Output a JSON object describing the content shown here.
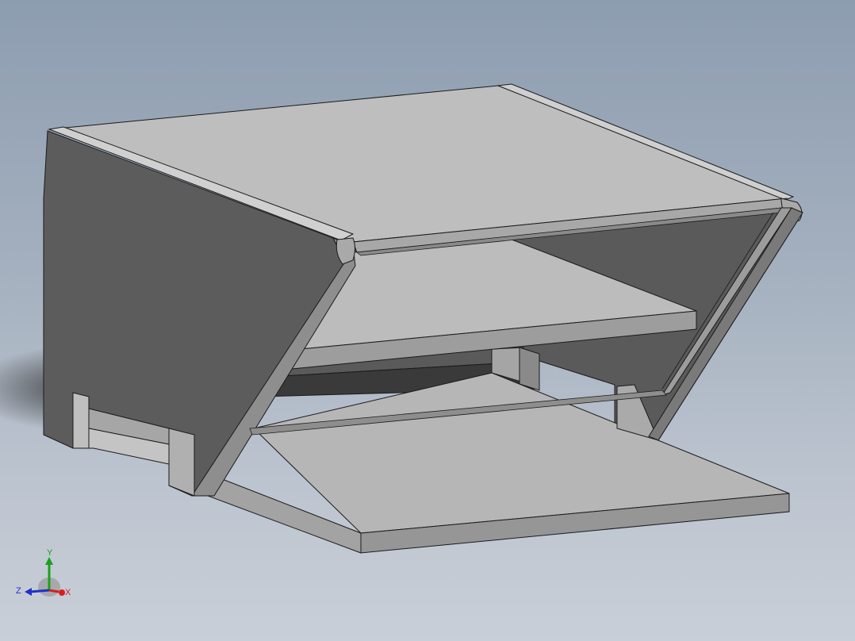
{
  "viewport": {
    "background_top": "#8d9db0",
    "background_bottom": "#c9cfd8"
  },
  "model": {
    "face_light": "#bdbdbd",
    "face_mid": "#9a9a9a",
    "face_dark": "#5b5b5b",
    "edge_color": "#1a1a1a"
  },
  "triad": {
    "x_label": "X",
    "y_label": "Y",
    "z_label": "Z",
    "x_color": "#d42020",
    "y_color": "#1aa21a",
    "z_color": "#2030c8"
  }
}
